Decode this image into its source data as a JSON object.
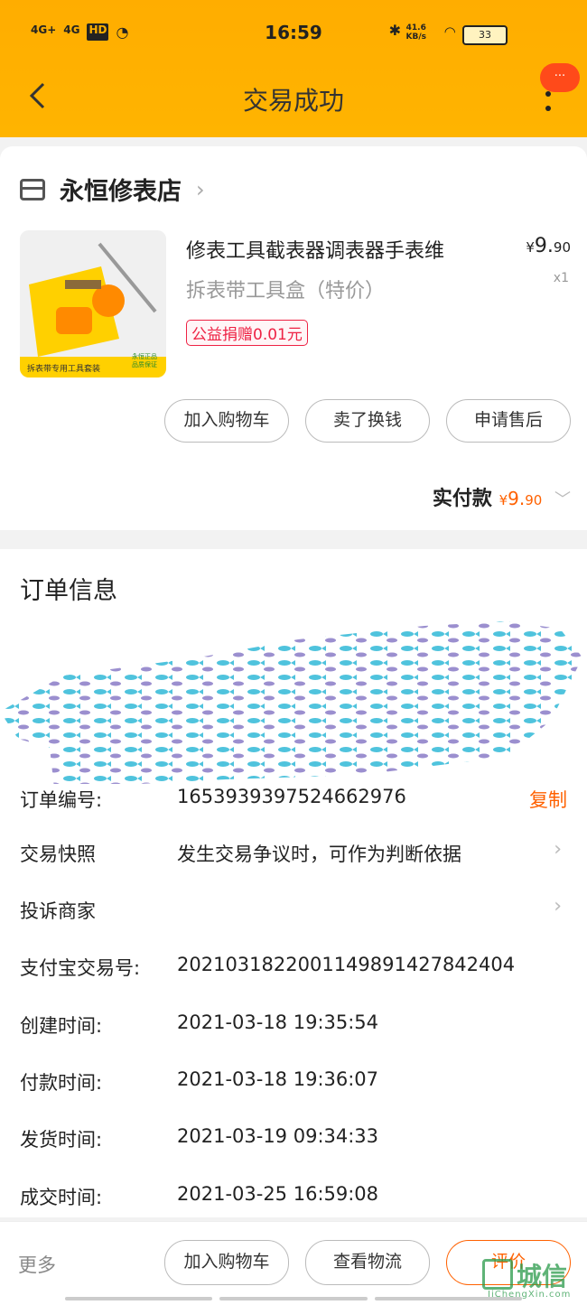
{
  "status_bar": {
    "signal_1": "4G+",
    "signal_2": "4G",
    "hd": "HD",
    "time": "16:59",
    "net_speed_value": "41.6",
    "net_speed_unit": "KB/s",
    "battery": "33"
  },
  "header": {
    "title": "交易成功",
    "menu_badge": "···"
  },
  "store": {
    "name": "永恒修表店"
  },
  "product": {
    "title_line1": "修表工具截表器调表器手表维",
    "title_line2": "拆表带工具盒（特价）",
    "price_symbol": "¥",
    "price_int": "9.",
    "price_dec": "90",
    "qty": "x1",
    "charity_tag": "公益捐赠0.01元",
    "image_caption": "拆表带专用工具套装",
    "image_badge": "永恒正品 品质保证"
  },
  "item_actions": [
    {
      "label": "加入购物车"
    },
    {
      "label": "卖了换钱"
    },
    {
      "label": "申请售后"
    }
  ],
  "payment": {
    "label": "实付款",
    "symbol": "¥",
    "amount_int": "9.",
    "amount_dec": "90"
  },
  "order_info": {
    "title": "订单信息",
    "rows": [
      {
        "label": "订单编号:",
        "value": "1653939397524662976",
        "action": "复制"
      },
      {
        "label": "交易快照",
        "value": "发生交易争议时，可作为判断依据"
      },
      {
        "label": "投诉商家",
        "value": ""
      },
      {
        "label": "支付宝交易号:",
        "value": "2021031822001149891427842404"
      },
      {
        "label": "创建时间:",
        "value": "2021-03-18 19:35:54"
      },
      {
        "label": "付款时间:",
        "value": "2021-03-18 19:36:07"
      },
      {
        "label": "发货时间:",
        "value": "2021-03-19 09:34:33"
      },
      {
        "label": "成交时间:",
        "value": "2021-03-25 16:59:08"
      }
    ]
  },
  "bottom_bar": {
    "more": "更多",
    "add_cart": "加入购物车",
    "logistics": "查看物流",
    "review": "评价"
  },
  "watermark": {
    "text": "城信",
    "sub": "JiChengXin.com"
  },
  "colors": {
    "header": "#ffad00",
    "accent": "#ff6100",
    "charity": "#ee2244"
  }
}
